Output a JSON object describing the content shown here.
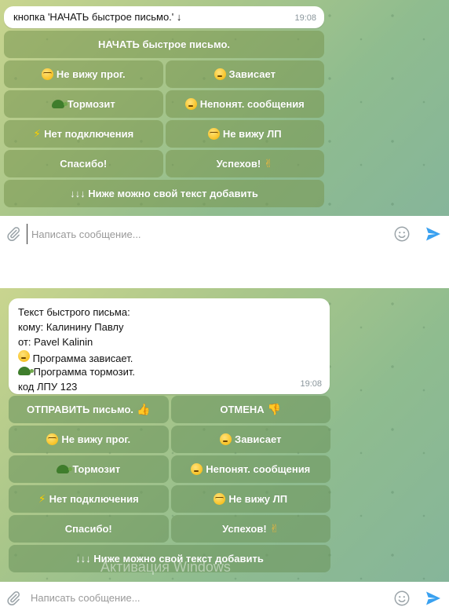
{
  "chat1": {
    "message": {
      "text": "кнопка 'НАЧАТЬ быстрое письмо.' ↓",
      "time": "19:08"
    },
    "keyboard": {
      "start": "НАЧАТЬ быстрое письмо.",
      "cant_see_prog": "Не вижу прог.",
      "freezes": "Зависает",
      "slow": "Тормозит",
      "unclear_messages": "Непонят. сообщения",
      "no_connection": "Нет подключения",
      "cant_see_lp": "Не вижу ЛП",
      "thanks": "Спасибо!",
      "good_luck": "Успехов!",
      "add_own_text": "↓↓↓ Ниже можно свой текст добавить"
    },
    "composer": {
      "placeholder": "Написать сообщение..."
    }
  },
  "chat2": {
    "message": {
      "line1": "Текст быстрого письма:",
      "line2": "кому: Калинину Павлу",
      "line3": "от: Pavel Kalinin",
      "line4": "Программа зависает.",
      "line5": "Программа тормозит.",
      "line6": "код ЛПУ 123",
      "time": "19:08"
    },
    "keyboard": {
      "send": "ОТПРАВИТЬ письмо.",
      "cancel": "ОТМЕНА",
      "cant_see_prog": "Не вижу прог.",
      "freezes": "Зависает",
      "slow": "Тормозит",
      "unclear_messages": "Непонят. сообщения",
      "no_connection": "Нет подключения",
      "cant_see_lp": "Не вижу ЛП",
      "thanks": "Спасибо!",
      "good_luck": "Успехов!",
      "add_own_text": "↓↓↓ Ниже можно свой текст добавить"
    },
    "composer": {
      "placeholder": "Написать сообщение..."
    }
  },
  "watermark": "Активация Windows",
  "colors": {
    "send_icon": "#3aa1f0",
    "keyboard_button": "#7f9a55",
    "bubble": "#ffffff",
    "time": "#8a969c"
  },
  "icons": {
    "attach": "paperclip-icon",
    "emoji": "smile-icon",
    "send": "send-arrow-icon"
  }
}
